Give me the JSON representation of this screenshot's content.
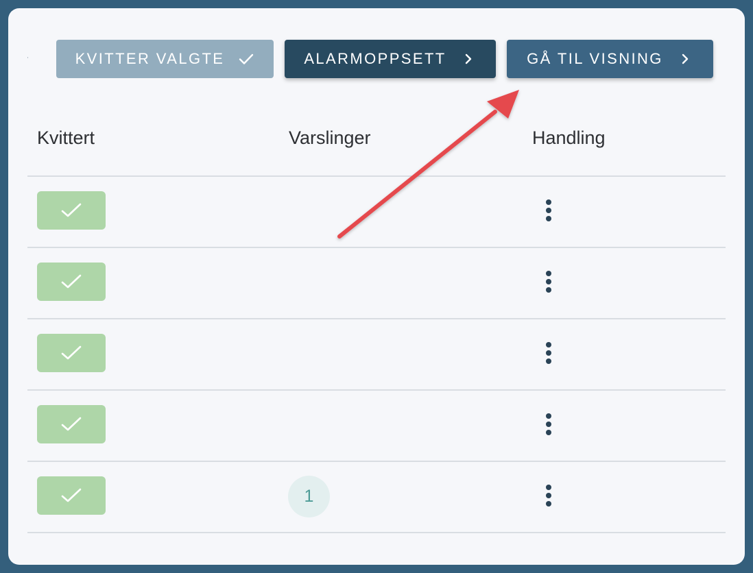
{
  "toolbar": {
    "kvitter_label": "KVITTER VALGTE",
    "alarm_label": "ALARMOPPSETT",
    "visning_label": "GÅ TIL VISNING",
    "kvitter_icon": "check-icon",
    "alarm_icon": "chevron-right-icon",
    "visning_icon": "chevron-right-icon"
  },
  "table": {
    "headers": {
      "kvittert": "Kvittert",
      "varslinger": "Varslinger",
      "handling": "Handling"
    },
    "rows": [
      {
        "kvittert": true,
        "varslinger": ""
      },
      {
        "kvittert": true,
        "varslinger": ""
      },
      {
        "kvittert": true,
        "varslinger": ""
      },
      {
        "kvittert": true,
        "varslinger": ""
      },
      {
        "kvittert": true,
        "varslinger": "1"
      }
    ]
  },
  "colors": {
    "background": "#345f7c",
    "card": "#f6f7fa",
    "kvitter_button": "#93adbe",
    "alarm_button": "#284a60",
    "visning_button": "#3c6584",
    "acknowledged": "#aed6a8",
    "badge_bg": "#e3efef",
    "badge_text": "#4d9b96",
    "annotation_arrow": "#e5484d"
  }
}
